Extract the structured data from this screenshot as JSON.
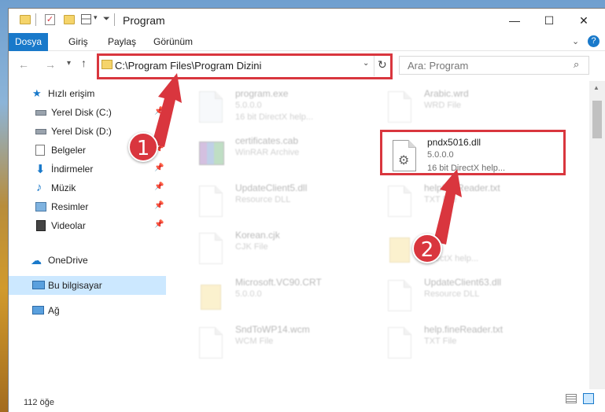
{
  "window": {
    "title": "Program",
    "controls": {
      "minimize": "—",
      "maximize": "☐",
      "close": "✕"
    }
  },
  "ribbon": {
    "tabs": [
      "Dosya",
      "Giriş",
      "Paylaş",
      "Görünüm"
    ],
    "active_tab": "Dosya",
    "expand_icon": "chevron-down-icon",
    "help_icon": "help-icon"
  },
  "navigation": {
    "address": "C:\\Program Files\\Program Dizini",
    "search_placeholder": "Ara: Program"
  },
  "sidebar": {
    "items": [
      {
        "label": "Hızlı erişim",
        "icon": "star-icon",
        "pinned": false
      },
      {
        "label": "Yerel Disk (C:)",
        "icon": "drive-icon",
        "pinned": true
      },
      {
        "label": "Yerel Disk (D:)",
        "icon": "drive-icon",
        "pinned": true
      },
      {
        "label": "Belgeler",
        "icon": "documents-icon",
        "pinned": true
      },
      {
        "label": "İndirmeler",
        "icon": "download-icon",
        "pinned": true
      },
      {
        "label": "Müzik",
        "icon": "music-icon",
        "pinned": true
      },
      {
        "label": "Resimler",
        "icon": "pictures-icon",
        "pinned": true
      },
      {
        "label": "Videolar",
        "icon": "videos-icon",
        "pinned": true
      },
      {
        "label": "OneDrive",
        "icon": "cloud-icon",
        "pinned": false
      },
      {
        "label": "Bu bilgisayar",
        "icon": "computer-icon",
        "pinned": false,
        "selected": true
      },
      {
        "label": "Ağ",
        "icon": "network-icon",
        "pinned": false
      }
    ]
  },
  "files": [
    {
      "name": "program.exe",
      "line1": "5.0.0.0",
      "line2": "16 bit DirectX help...",
      "icon": "exe-icon"
    },
    {
      "name": "Arabic.wrd",
      "line1": "WRD File",
      "line2": "",
      "icon": "file-icon"
    },
    {
      "name": "certificates.cab",
      "line1": "WinRAR Archive",
      "line2": "",
      "icon": "archive-icon"
    },
    {
      "name": "pndx5016.dll",
      "line1": "5.0.0.0",
      "line2": "16 bit DirectX help...",
      "icon": "dll-gear-icon",
      "highlighted": true
    },
    {
      "name": "UpdateClient5.dll",
      "line1": "Resource DLL",
      "line2": "",
      "icon": "dll-gear-icon"
    },
    {
      "name": "helpfineReader.txt",
      "line1": "TXT File",
      "line2": "",
      "icon": "file-icon"
    },
    {
      "name": "Korean.cjk",
      "line1": "CJK File",
      "line2": "",
      "icon": "file-icon"
    },
    {
      "name": "",
      "line1": "",
      "line2": "DirectX help...",
      "icon": "folder-icon"
    },
    {
      "name": "Microsoft.VC90.CRT",
      "line1": "5.0.0.0",
      "line2": "",
      "icon": "folder-icon"
    },
    {
      "name": "UpdateClient63.dll",
      "line1": "Resource DLL",
      "line2": "",
      "icon": "dll-gear-icon"
    },
    {
      "name": "SndToWP14.wcm",
      "line1": "WCM File",
      "line2": "",
      "icon": "file-icon"
    },
    {
      "name": "help.fineReader.txt",
      "line1": "TXT File",
      "line2": "",
      "icon": "file-icon"
    }
  ],
  "status": {
    "item_count": "112 öğe"
  },
  "annotations": {
    "step1": "1",
    "step2": "2",
    "color": "#d9363e"
  },
  "colors": {
    "accent": "#1979ca",
    "selection": "#cce8ff"
  }
}
